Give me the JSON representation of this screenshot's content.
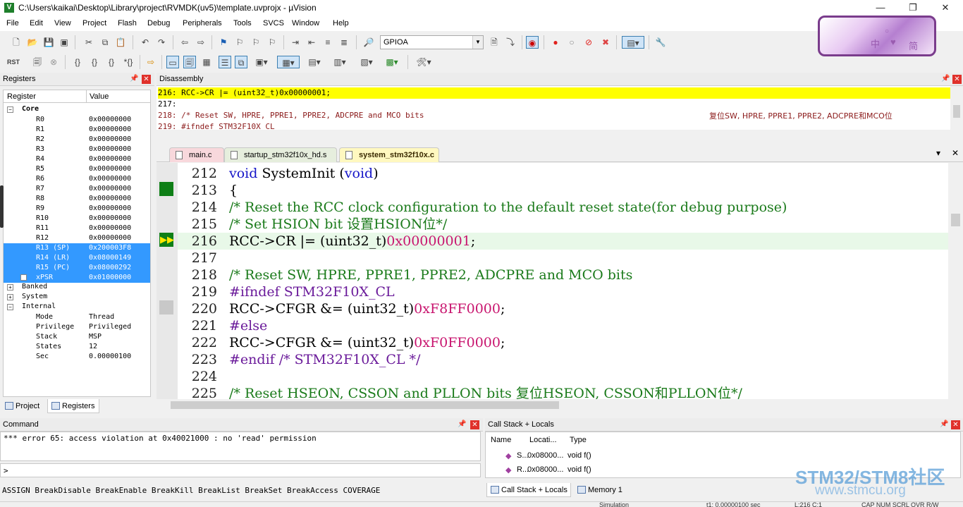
{
  "window": {
    "title": "C:\\Users\\kaikai\\Desktop\\Library\\project\\RVMDK(uv5)\\template.uvprojx - µVision",
    "app_icon": "uvision-icon",
    "minimize": "—",
    "maximize": "❐",
    "close": "✕"
  },
  "menu": [
    "File",
    "Edit",
    "View",
    "Project",
    "Flash",
    "Debug",
    "Peripherals",
    "Tools",
    "SVCS",
    "Window",
    "Help"
  ],
  "toolbar": {
    "target": "GPIOA",
    "reset_label": "RST"
  },
  "logo": {
    "zh": "中",
    "heart": "♥",
    "jian": "简",
    "circle": "○"
  },
  "registers": {
    "title": "Registers",
    "pin": "📌",
    "close": "✕",
    "col_register": "Register",
    "col_value": "Value",
    "core_label": "Core",
    "rows": [
      {
        "name": "R0",
        "value": "0x00000000"
      },
      {
        "name": "R1",
        "value": "0x00000000"
      },
      {
        "name": "R2",
        "value": "0x00000000"
      },
      {
        "name": "R3",
        "value": "0x00000000"
      },
      {
        "name": "R4",
        "value": "0x00000000"
      },
      {
        "name": "R5",
        "value": "0x00000000"
      },
      {
        "name": "R6",
        "value": "0x00000000"
      },
      {
        "name": "R7",
        "value": "0x00000000"
      },
      {
        "name": "R8",
        "value": "0x00000000"
      },
      {
        "name": "R9",
        "value": "0x00000000"
      },
      {
        "name": "R10",
        "value": "0x00000000"
      },
      {
        "name": "R11",
        "value": "0x00000000"
      },
      {
        "name": "R12",
        "value": "0x00000000"
      },
      {
        "name": "R13 (SP)",
        "value": "0x200003F8"
      },
      {
        "name": "R14 (LR)",
        "value": "0x08000149"
      },
      {
        "name": "R15 (PC)",
        "value": "0x08000292"
      },
      {
        "name": "xPSR",
        "value": "0x01000000"
      }
    ],
    "banked": "Banked",
    "system": "System",
    "internal": "Internal",
    "internal_rows": [
      {
        "name": "Mode",
        "value": "Thread"
      },
      {
        "name": "Privilege",
        "value": "Privileged"
      },
      {
        "name": "Stack",
        "value": "MSP"
      },
      {
        "name": "States",
        "value": "12"
      },
      {
        "name": "Sec",
        "value": "0.00000100"
      }
    ],
    "tab_project": "Project",
    "tab_registers": "Registers"
  },
  "disassembly": {
    "title": "Disassembly",
    "lines": [
      "   216:   RCC->CR |= (uint32_t)0x00000001;",
      "   217:",
      "   218:   /* Reset SW, HPRE, PPRE1, PPRE2, ADCPRE and MCO bits",
      "   219: #ifndef STM32F10X_CL"
    ],
    "line218_comment": "复位SW, HPRE, PPRE1, PPRE2, ADCPRE和MCO位"
  },
  "editor": {
    "tabs": [
      "main.c",
      "startup_stm32f10x_hd.s",
      "system_stm32f10x.c"
    ],
    "active_tab": "system_stm32f10x.c",
    "lines": [
      {
        "n": "212",
        "t": "void SystemInit (void)"
      },
      {
        "n": "213",
        "t": "{"
      },
      {
        "n": "214",
        "t": "  /* Reset the RCC clock configuration to the default reset state(for debug purpose)"
      },
      {
        "n": "215",
        "t": "  /* Set HSION bit 设置HSION位*/"
      },
      {
        "n": "216",
        "t": "  RCC->CR |= (uint32_t)0x00000001;"
      },
      {
        "n": "217",
        "t": ""
      },
      {
        "n": "218",
        "t": "  /* Reset SW, HPRE, PPRE1, PPRE2, ADCPRE and MCO bits"
      },
      {
        "n": "219",
        "t": "#ifndef STM32F10X_CL"
      },
      {
        "n": "220",
        "t": "  RCC->CFGR &= (uint32_t)0xF8FF0000;"
      },
      {
        "n": "221",
        "t": "#else"
      },
      {
        "n": "222",
        "t": "  RCC->CFGR &= (uint32_t)0xF0FF0000;"
      },
      {
        "n": "223",
        "t": "#endif /* STM32F10X_CL */"
      },
      {
        "n": "224",
        "t": ""
      },
      {
        "n": "225",
        "t": "  /* Reset HSEON, CSSON and PLLON bits      复位HSEON, CSSON和PLLON位*/"
      }
    ],
    "tab_menu": "▾",
    "tab_close": "✕"
  },
  "command": {
    "title": "Command",
    "output": "*** error 65: access violation at 0x40021000 : no 'read' permission",
    "prompt": ">",
    "hints": "ASSIGN BreakDisable BreakEnable BreakKill BreakList BreakSet BreakAccess COVERAGE"
  },
  "callstack": {
    "title": "Call Stack + Locals",
    "col_name": "Name",
    "col_location": "Locati...",
    "col_type": "Type",
    "rows": [
      {
        "name": "S...",
        "location": "0x08000...",
        "type": "void f()"
      },
      {
        "name": "R...",
        "location": "0x08000...",
        "type": "void f()"
      }
    ],
    "tab_callstack": "Call Stack + Locals",
    "tab_memory": "Memory 1"
  },
  "watermark": {
    "line1": "STM32/STM8社区",
    "line2": "www.stmcu.org"
  },
  "status": {
    "mode": "Simulation",
    "time": "t1: 0.00000100 sec",
    "position": "L:216 C:1",
    "flags": "CAP  NUM  SCRL  OVR  R/W"
  }
}
